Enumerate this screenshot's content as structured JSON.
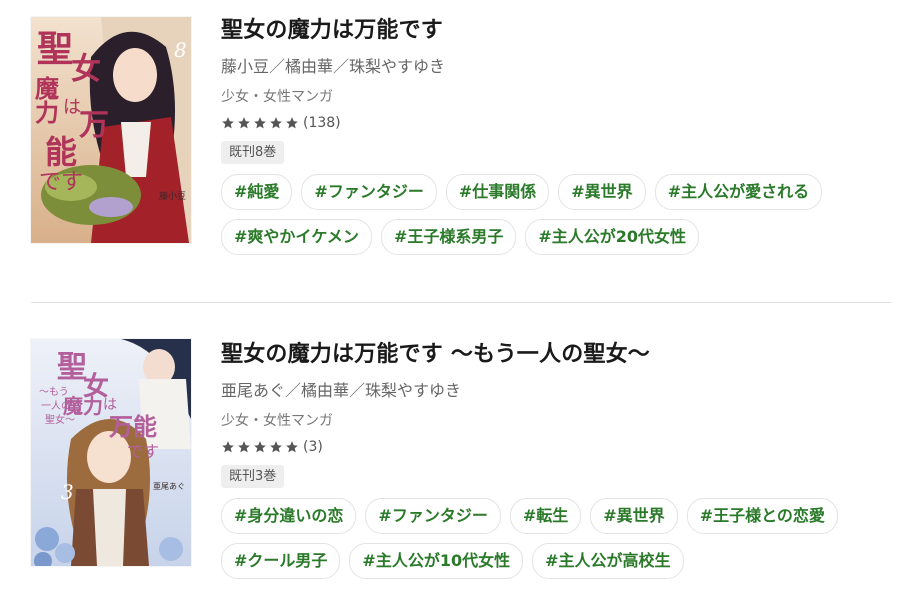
{
  "items": [
    {
      "title": "聖女の魔力は万能です",
      "authors": "藤小豆／橘由華／珠梨やすゆき",
      "genre": "少女・女性マンガ",
      "rating_stars": 5,
      "rating_count": "(138)",
      "volumes": "既刊8巻",
      "cover": {
        "title_text": "聖女の魔力は万能です",
        "volume_text": "8",
        "author_text": "藤小豆",
        "colors": {
          "bg": "#e9cdb0",
          "title": "#b0345a",
          "dress": "#a3222a",
          "hair": "#2a1f2a",
          "plants": "#7c8e3a"
        }
      },
      "tags": [
        "#純愛",
        "#ファンタジー",
        "#仕事関係",
        "#異世界",
        "#主人公が愛される",
        "#爽やかイケメン",
        "#王子様系男子",
        "#主人公が20代女性"
      ]
    },
    {
      "title": "聖女の魔力は万能です ～もう一人の聖女～",
      "authors": "亜尾あぐ／橘由華／珠梨やすゆき",
      "genre": "少女・女性マンガ",
      "rating_stars": 5,
      "rating_count": "(3)",
      "volumes": "既刊3巻",
      "cover": {
        "title_text": "聖女の魔力は万能です",
        "subtitle_text": "～もう一人の聖女～",
        "volume_text": "3",
        "author_text": "亜尾あぐ",
        "colors": {
          "bg": "#dfe6f3",
          "title": "#b35f9c",
          "dress": "#7a4a33",
          "hair": "#9c6b3e",
          "flowers": "#8aa8d8"
        }
      },
      "tags": [
        "#身分違いの恋",
        "#ファンタジー",
        "#転生",
        "#異世界",
        "#王子様との恋愛",
        "#クール男子",
        "#主人公が10代女性",
        "#主人公が高校生"
      ]
    }
  ],
  "colors": {
    "tag_text": "#2a7a2a",
    "star": "#555555"
  }
}
